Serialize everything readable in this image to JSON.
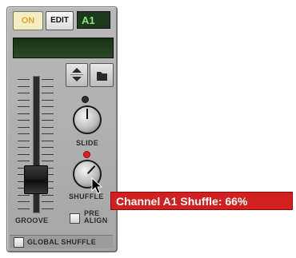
{
  "controls": {
    "on_label": "ON",
    "edit_label": "EDIT",
    "pattern_label": "A1"
  },
  "fader": {
    "label": "GROOVE",
    "level": 0.18
  },
  "knobs": {
    "slide": {
      "label": "SLIDE",
      "value": 0.5
    },
    "shuffle": {
      "label": "SHUFFLE",
      "value": 0.66
    }
  },
  "pre_align": {
    "line1": "PRE",
    "line2": "ALIGN",
    "checked": false
  },
  "global_shuffle": {
    "label": "GLOBAL SHUFFLE",
    "checked": false
  },
  "tooltip": {
    "text": "Channel A1 Shuffle: 66%"
  },
  "colors": {
    "tooltip_bg": "#d21f1f",
    "lcd": "#294a25",
    "on_button": "#f4edc3",
    "led_red": "#e02020"
  },
  "icons": [
    "arrow-up-down-icon",
    "folder-icon",
    "mouse-cursor-icon"
  ]
}
